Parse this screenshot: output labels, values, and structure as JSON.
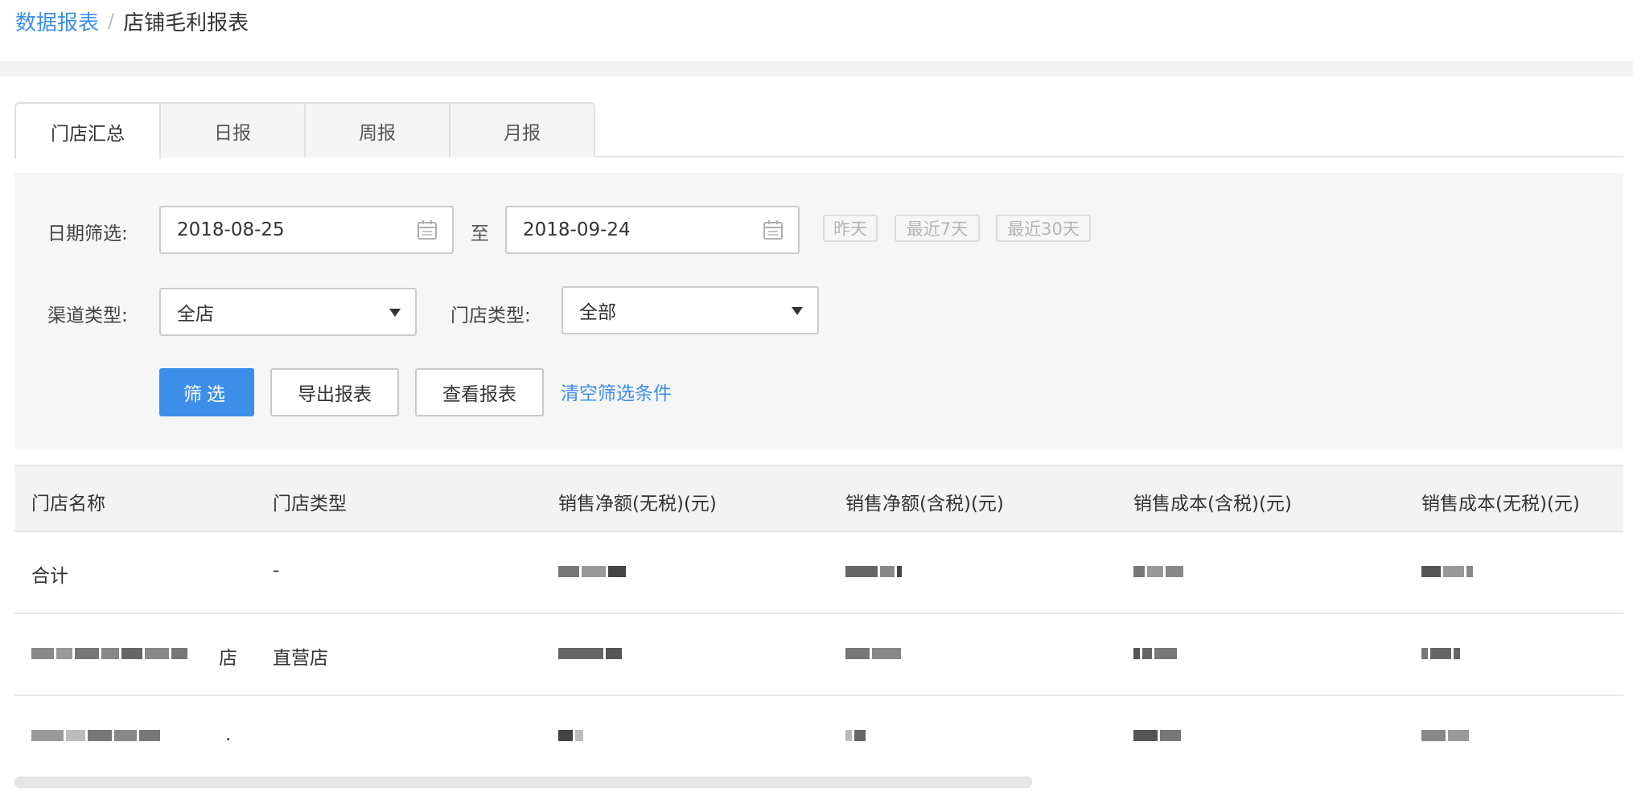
{
  "breadcrumb": {
    "parent": "数据报表",
    "separator": "/",
    "current": "店铺毛利报表"
  },
  "tabs": [
    {
      "label": "门店汇总",
      "active": true
    },
    {
      "label": "日报",
      "active": false
    },
    {
      "label": "周报",
      "active": false
    },
    {
      "label": "月报",
      "active": false
    }
  ],
  "filters": {
    "date_label": "日期筛选:",
    "start_date": "2018-08-25",
    "to_label": "至",
    "end_date": "2018-09-24",
    "quick_ranges": [
      "昨天",
      "最近7天",
      "最近30天"
    ],
    "channel_label": "渠道类型:",
    "channel_value": "全店",
    "store_type_label": "门店类型:",
    "store_type_value": "全部",
    "filter_button": "筛选",
    "export_button": "导出报表",
    "view_button": "查看报表",
    "clear_link": "清空筛选条件"
  },
  "table": {
    "columns": [
      "门店名称",
      "门店类型",
      "销售净额(无税)(元)",
      "销售净额(含税)(元)",
      "销售成本(含税)(元)",
      "销售成本(无税)(元)"
    ],
    "rows": [
      {
        "name": "合计",
        "type": "-"
      },
      {
        "name_suffix": "店",
        "type": "直营店"
      },
      {
        "name_suffix": ".",
        "type": ""
      }
    ]
  },
  "colors": {
    "accent": "#3d8ee8",
    "panel_bg": "#f6f6f6",
    "header_bg": "#f3f3f3"
  },
  "icons": {
    "calendar": "calendar-icon",
    "dropdown": "caret-down-icon"
  }
}
